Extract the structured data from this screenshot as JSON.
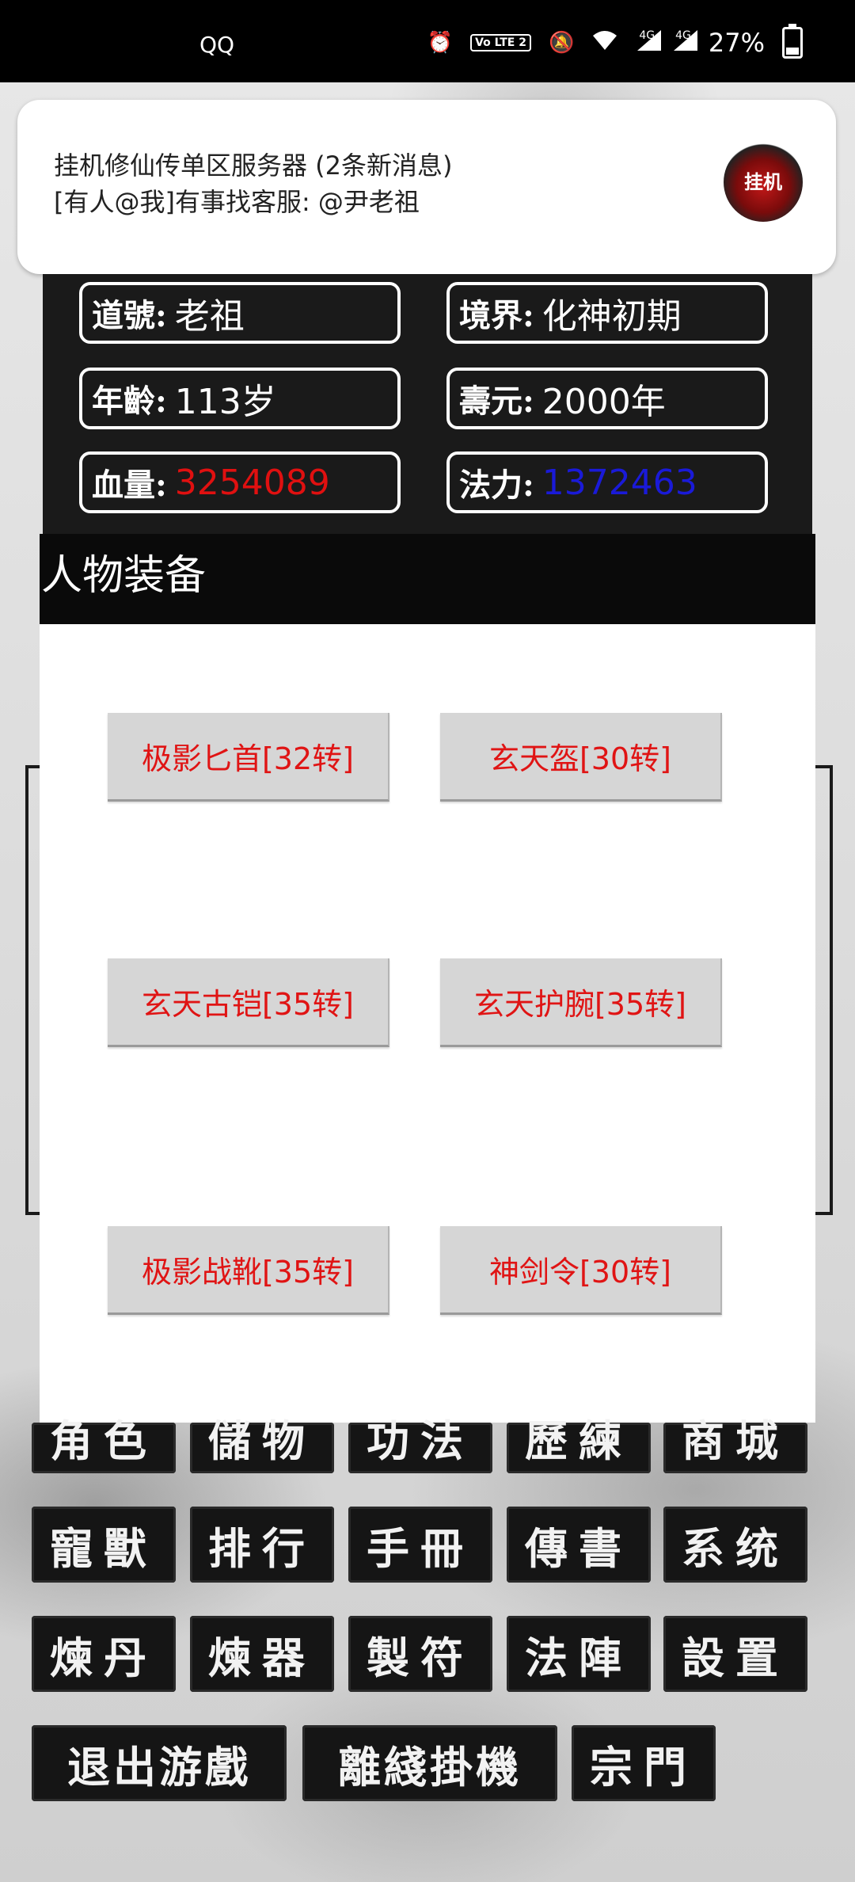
{
  "status_bar": {
    "app_label": "QQ",
    "network_1": "4G",
    "network_2": "4G",
    "volte": "Vo LTE 2",
    "battery_text": "27%"
  },
  "notification": {
    "title": "挂机修仙传单区服务器 (2条新消息)",
    "message": "[有人@我]有事找客服: @尹老祖",
    "logo_text": "挂机"
  },
  "stats": {
    "daohao": {
      "label": "道號:",
      "value": "老祖"
    },
    "jingjie": {
      "label": "境界:",
      "value": "化神初期"
    },
    "nianling": {
      "label": "年齡:",
      "value": "113岁"
    },
    "shouyuan": {
      "label": "壽元:",
      "value": "2000年"
    },
    "xueliang": {
      "label": "血量:",
      "value": "3254089"
    },
    "fali": {
      "label": "法力:",
      "value": "1372463"
    }
  },
  "equipment_dialog": {
    "title": "人物装备",
    "items": [
      "极影匕首[32转]",
      "玄天盔[30转]",
      "玄天古铠[35转]",
      "玄天护腕[35转]",
      "极影战靴[35转]",
      "神剑令[30转]"
    ]
  },
  "menu": {
    "row1": [
      "角色",
      "儲物",
      "功法",
      "歷練",
      "商城"
    ],
    "row2": [
      "寵獸",
      "排行",
      "手冊",
      "傳書",
      "系统"
    ],
    "row3": [
      "煉丹",
      "煉器",
      "製符",
      "法陣",
      "設置"
    ],
    "row4": [
      "退出游戲",
      "離綫掛機",
      "宗門"
    ]
  },
  "colors": {
    "hp_red": "#e01010",
    "mp_blue": "#1a1ad8",
    "equip_text_red": "#e01414"
  }
}
